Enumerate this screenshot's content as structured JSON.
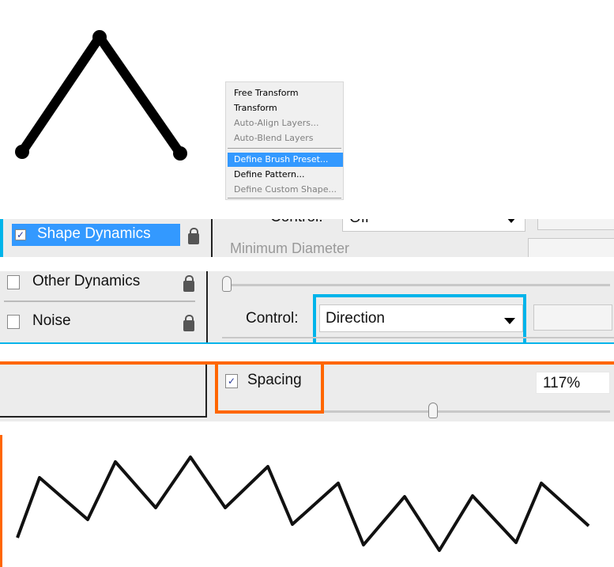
{
  "accent_colors": {
    "cyan": "#00b4ea",
    "orange": "#ff6600",
    "highlight": "#3399ff"
  },
  "context_menu": {
    "items": [
      {
        "label": "Free Transform",
        "enabled": true
      },
      {
        "label": "Transform",
        "enabled": true
      },
      {
        "label": "Auto-Align Layers...",
        "enabled": false
      },
      {
        "label": "Auto-Blend Layers",
        "enabled": false
      },
      {
        "label": "Define Brush Preset...",
        "enabled": true,
        "highlighted": true
      },
      {
        "label": "Define Pattern...",
        "enabled": true
      },
      {
        "label": "Define Custom Shape...",
        "enabled": false
      }
    ]
  },
  "brush_panel": {
    "shape_dynamics": {
      "label": "Shape Dynamics",
      "checked": true,
      "control_label": "Control:",
      "control_value": "Off",
      "min_diameter_label": "Minimum Diameter"
    },
    "other_dynamics": {
      "label": "Other Dynamics",
      "checked": false
    },
    "noise": {
      "label": "Noise",
      "checked": false
    },
    "angle_control": {
      "label": "Control:",
      "value": "Direction"
    },
    "spacing": {
      "label": "Spacing",
      "checked": true,
      "value": "117%"
    }
  }
}
